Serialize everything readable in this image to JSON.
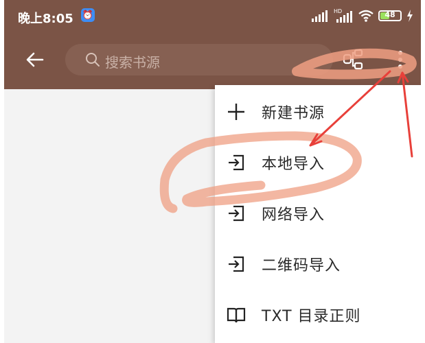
{
  "status_bar": {
    "time": "晚上8:05",
    "app_icon": "alarm-app-icon",
    "network": "HD",
    "battery": "48",
    "battery_level_pct": 48
  },
  "toolbar": {
    "back_icon": "arrow-left-icon",
    "search_placeholder": "搜索书源",
    "search_icon": "search-icon",
    "qr_icon": "qr-scan-icon",
    "more_icon": "more-vertical-icon"
  },
  "menu": {
    "items": [
      {
        "label": "新建书源",
        "icon": "plus-icon"
      },
      {
        "label": "本地导入",
        "icon": "import-icon"
      },
      {
        "label": "网络导入",
        "icon": "import-icon"
      },
      {
        "label": "二维码导入",
        "icon": "import-icon"
      },
      {
        "label": "TXT 目录正则",
        "icon": "book-open-icon"
      }
    ]
  },
  "colors": {
    "toolbar": "#7b5446",
    "search_box": "#866052",
    "annotation_highlight": "#ef9f83",
    "annotation_arrow": "#e8403a"
  }
}
